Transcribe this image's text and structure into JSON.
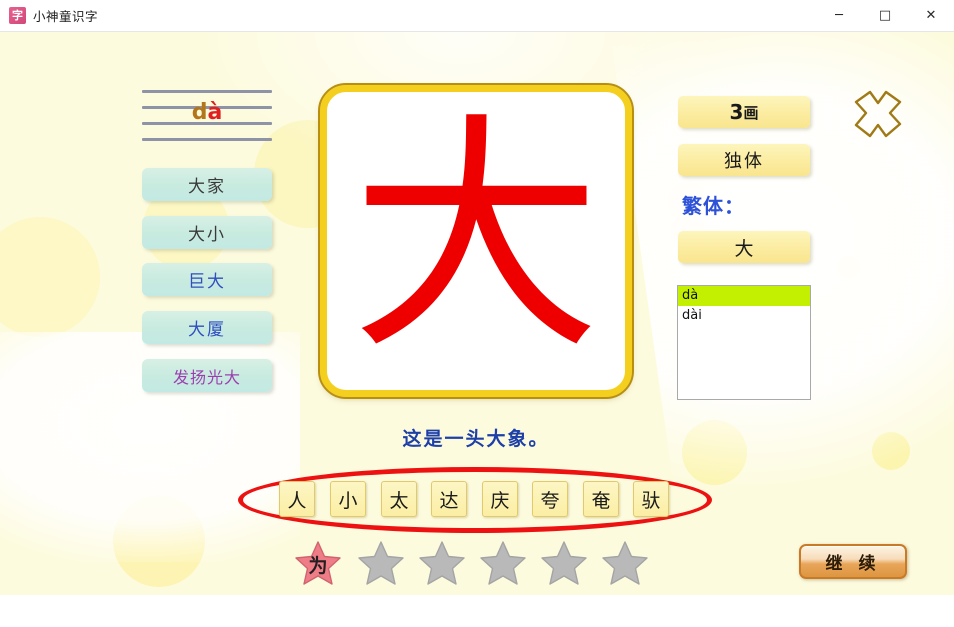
{
  "window": {
    "title": "小神童识字",
    "icon_glyph": "字",
    "icon_name": "app-icon",
    "minimize": "─",
    "maximize": "□",
    "close": "✕"
  },
  "pinyin": {
    "initial": "d",
    "final": "à",
    "full": "dà"
  },
  "words": [
    {
      "label": "大家",
      "style": "dark"
    },
    {
      "label": "大小",
      "style": "dark"
    },
    {
      "label": "巨大",
      "style": "blue"
    },
    {
      "label": "大厦",
      "style": "blue"
    },
    {
      "label": "发扬光大",
      "style": "purple"
    }
  ],
  "character": {
    "glyph": "大",
    "color": "#ee0000"
  },
  "sentence": "这是一头大象。",
  "info": {
    "strokes_number": "3",
    "strokes_unit": "画",
    "structure": "独体",
    "traditional_label": "繁体：",
    "traditional_char": "大"
  },
  "pronunciations": [
    {
      "value": "dà",
      "selected": true
    },
    {
      "value": "dài",
      "selected": false
    }
  ],
  "tiles": [
    "人",
    "小",
    "太",
    "达",
    "庆",
    "夸",
    "奄",
    "驮"
  ],
  "stars": [
    {
      "label": "为",
      "earned": true
    },
    {
      "label": "",
      "earned": false
    },
    {
      "label": "",
      "earned": false
    },
    {
      "label": "",
      "earned": false
    },
    {
      "label": "",
      "earned": false
    },
    {
      "label": "",
      "earned": false
    }
  ],
  "continue_button": "继 续",
  "colors": {
    "background": "#fdfbde",
    "accent_yellow": "#f5cf1e",
    "char_red": "#ee0000",
    "ellipse_red": "#ee1111",
    "highlight_green": "#c3f000",
    "word_chip": "#c9ebdf",
    "continue_orange": "#dd9540",
    "trad_label_blue": "#2d52d8"
  }
}
